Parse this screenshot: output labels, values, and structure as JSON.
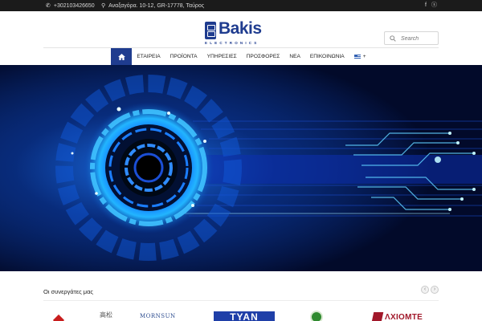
{
  "topbar": {
    "phone": "+302103426650",
    "address": "Αναξαγόρα. 10-12, GR-17778, Ταύρος",
    "social": [
      "facebook-icon",
      "skype-icon"
    ]
  },
  "header": {
    "logo_name": "Bakis",
    "logo_sub": "ELECTRONICS",
    "search_placeholder": "Search"
  },
  "nav": {
    "items": [
      "ΕΤΑΙΡΕΙΑ",
      "ΠΡΟΪΟΝΤΑ",
      "ΥΠΗΡΕΣΙΕΣ",
      "ΠΡΟΣΦΟΡΕΣ",
      "ΝΕΑ",
      "ΕΠΙΚΟΙΝΩΝΙΑ"
    ],
    "home_icon": "home-icon",
    "language_suffix": "+"
  },
  "partners": {
    "title": "Οι συνεργάτες μας",
    "logos": [
      "高松",
      "MORNSUN",
      "TYAN",
      "ΛXIOMTE"
    ]
  },
  "colors": {
    "brand": "#1f3c8f",
    "topbar_bg": "#1b1b1b"
  }
}
